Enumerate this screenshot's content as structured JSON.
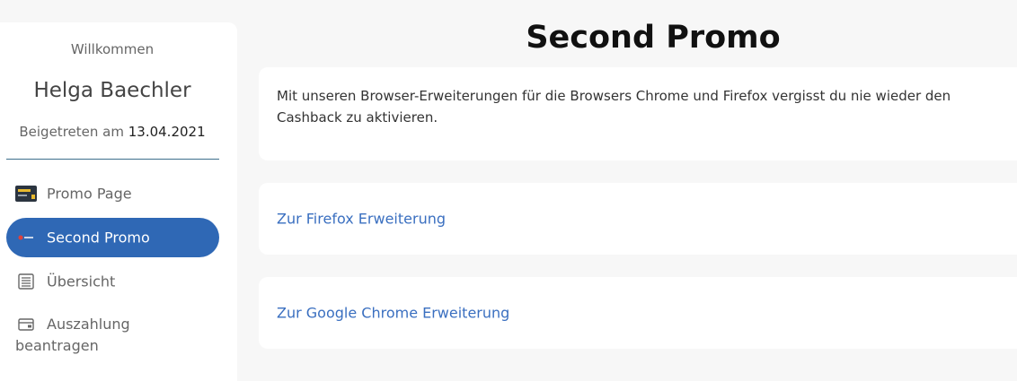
{
  "sidebar": {
    "welcome": "Willkommen",
    "username": "Helga Baechler",
    "joined_label": "Beigetreten am",
    "joined_date": "13.04.2021",
    "items": [
      {
        "label": "Promo Page",
        "icon": "promo-card-icon",
        "active": false
      },
      {
        "label": "Second Promo",
        "icon": "promo-icon",
        "active": true
      },
      {
        "label": "Übersicht",
        "icon": "list-icon",
        "active": false
      },
      {
        "label": "Auszahlung",
        "label2": "beantragen",
        "icon": "wallet-icon",
        "active": false
      }
    ]
  },
  "main": {
    "title": "Second Promo",
    "description": "Mit unseren Browser-Erweiterungen für die Browsers Chrome und Firefox vergisst du nie wieder den Cashback zu aktivieren.",
    "links": [
      {
        "label": "Zur Firefox Erweiterung"
      },
      {
        "label": "Zur Google Chrome Erweiterung"
      }
    ]
  },
  "colors": {
    "accent": "#2f68b5",
    "link": "#3a6fc0",
    "background": "#f7f7f7"
  }
}
